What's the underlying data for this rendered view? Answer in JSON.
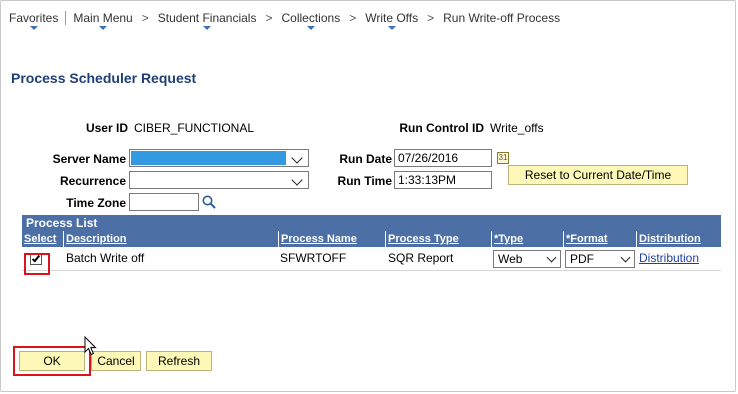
{
  "breadcrumb": {
    "items": [
      {
        "label": "Favorites",
        "dropdown": true
      },
      {
        "label": "Main Menu",
        "dropdown": true
      },
      {
        "label": "Student Financials",
        "dropdown": true
      },
      {
        "label": "Collections",
        "dropdown": true
      },
      {
        "label": "Write Offs",
        "dropdown": true
      },
      {
        "label": "Run Write-off Process",
        "dropdown": false
      }
    ]
  },
  "page_title": "Process Scheduler Request",
  "user": {
    "label": "User ID",
    "value": "CIBER_FUNCTIONAL"
  },
  "run_control": {
    "label": "Run Control ID",
    "value": "Write_offs"
  },
  "server_name": {
    "label": "Server Name",
    "value": ""
  },
  "recurrence": {
    "label": "Recurrence",
    "value": ""
  },
  "time_zone": {
    "label": "Time Zone",
    "value": ""
  },
  "run_date": {
    "label": "Run Date",
    "value": "07/26/2016"
  },
  "run_time": {
    "label": "Run Time",
    "value": "1:33:13PM"
  },
  "reset_button": "Reset to Current Date/Time",
  "process_list": {
    "title": "Process List",
    "columns": [
      "Select",
      "Description",
      "Process Name",
      "Process Type",
      "*Type",
      "*Format",
      "Distribution"
    ],
    "rows": [
      {
        "selected": true,
        "description": "Batch Write off",
        "process_name": "SFWRTOFF",
        "process_type": "SQR Report",
        "type": "Web",
        "format": "PDF",
        "distribution": "Distribution"
      }
    ]
  },
  "buttons": {
    "ok": "OK",
    "cancel": "Cancel",
    "refresh": "Refresh"
  },
  "colors": {
    "title": "#1f3f76",
    "grid_header": "#4c6fa5",
    "button_bg": "#fdf7b8",
    "highlight": "#d9141c",
    "server_name_selected": "#3399e0"
  }
}
